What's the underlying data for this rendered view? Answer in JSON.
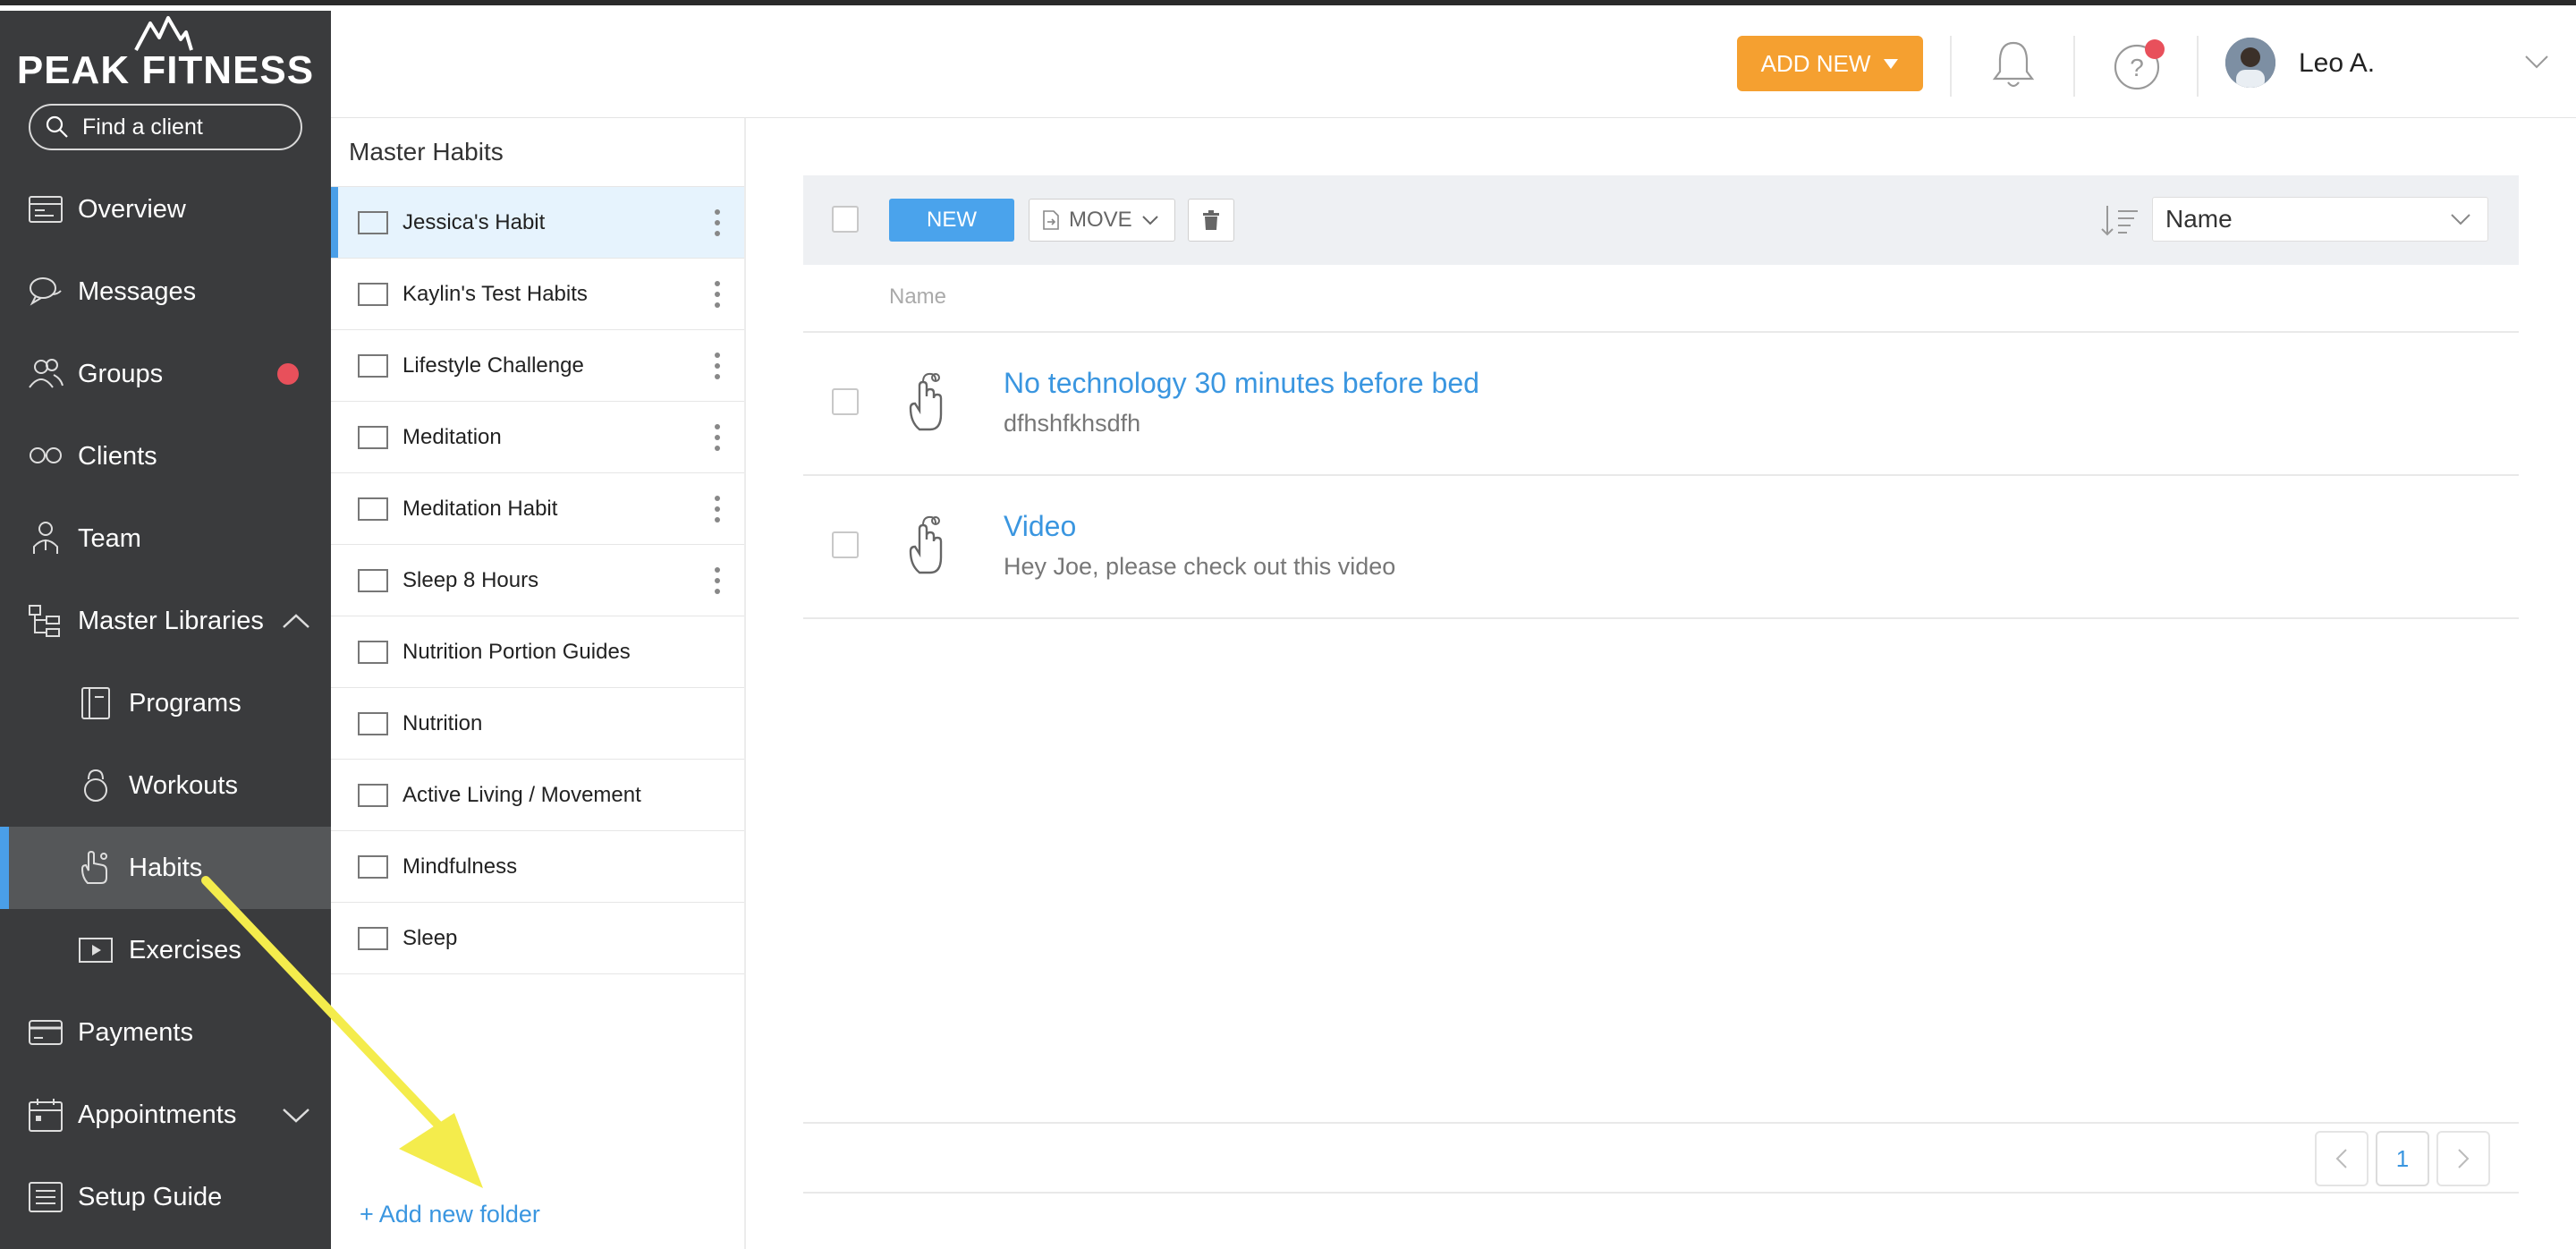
{
  "brand": {
    "name": "PEAK FITNESS"
  },
  "search": {
    "placeholder": "Find a client"
  },
  "sidebar": {
    "items": [
      {
        "label": "Overview",
        "icon": "overview-icon"
      },
      {
        "label": "Messages",
        "icon": "messages-icon"
      },
      {
        "label": "Groups",
        "icon": "groups-icon",
        "badge": true
      },
      {
        "label": "Clients",
        "icon": "clients-icon"
      },
      {
        "label": "Team",
        "icon": "team-icon"
      },
      {
        "label": "Master Libraries",
        "icon": "master-libraries-icon",
        "expanded": true
      },
      {
        "label": "Programs",
        "icon": "programs-icon"
      },
      {
        "label": "Workouts",
        "icon": "workouts-icon"
      },
      {
        "label": "Habits",
        "icon": "habits-icon",
        "active": true
      },
      {
        "label": "Exercises",
        "icon": "exercises-icon"
      },
      {
        "label": "Payments",
        "icon": "payments-icon"
      },
      {
        "label": "Appointments",
        "icon": "appointments-icon"
      },
      {
        "label": "Setup Guide",
        "icon": "setup-guide-icon"
      }
    ]
  },
  "header": {
    "add_new_label": "ADD NEW",
    "user_name": "Leo A."
  },
  "folders": {
    "title": "Master Habits",
    "items": [
      {
        "name": "Jessica's Habit",
        "menu": true,
        "active": true
      },
      {
        "name": "Kaylin's Test Habits",
        "menu": true
      },
      {
        "name": "Lifestyle Challenge",
        "menu": true
      },
      {
        "name": "Meditation",
        "menu": true
      },
      {
        "name": "Meditation Habit",
        "menu": true
      },
      {
        "name": "Sleep 8 Hours",
        "menu": true
      },
      {
        "name": "Nutrition Portion Guides",
        "menu": false
      },
      {
        "name": "Nutrition",
        "menu": false
      },
      {
        "name": "Active Living / Movement",
        "menu": false
      },
      {
        "name": "Mindfulness",
        "menu": false
      },
      {
        "name": "Sleep",
        "menu": false
      }
    ],
    "add_label": "+ Add new folder"
  },
  "toolbar": {
    "new_label": "NEW",
    "move_label": "MOVE",
    "sort_value": "Name"
  },
  "table": {
    "column_name": "Name",
    "rows": [
      {
        "title": "No technology 30 minutes before bed",
        "subtitle": "dfhshfkhsdfh"
      },
      {
        "title": "Video",
        "subtitle": "Hey Joe, please check out this video"
      }
    ]
  },
  "pagination": {
    "current_page": "1"
  },
  "colors": {
    "sidebar_bg": "#3a3b3d",
    "accent_blue": "#4aa3ec",
    "add_new_orange": "#f5a030",
    "notification_red": "#e8505b",
    "annotation_arrow": "#f4ec4c"
  }
}
